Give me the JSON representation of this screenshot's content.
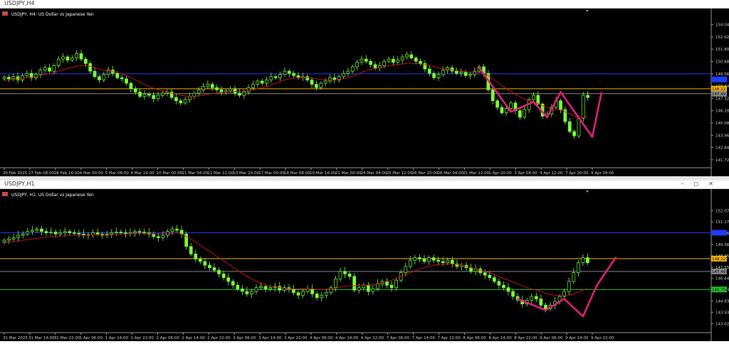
{
  "windows": [
    {
      "title": "USDJPY,H4",
      "header": "USDJPY, H4:  US Dollar vs Japanese Yen",
      "chart_data": {
        "type": "candlestick",
        "symbol": "USDJPY",
        "timeframe": "H4",
        "description": "US Dollar vs Japanese Yen",
        "ylim": [
          141.0,
          154.6
        ],
        "y_ticks": [
          "154.04",
          "152.92",
          "151.80",
          "150.68",
          "149.56",
          "148.44",
          "147.32",
          "146.20",
          "145.08",
          "143.96",
          "142.84",
          "141.72"
        ],
        "x_labels": [
          "26 Feb 2025",
          "27 Feb 08:00",
          "28 Feb 16:00",
          "4 Mar 00:00",
          "5 Mar 08:00",
          "6 Mar 16:00",
          "10 Mar 00:00",
          "11 Mar 04:00",
          "12 Mar 12:00",
          "13 Mar 20:00",
          "17 Mar 00:00",
          "18 Mar 08:00",
          "19 Mar 16:00",
          "21 Mar 00:00",
          "24 Mar 04:00",
          "25 Mar 12:00",
          "26 Mar 20:00",
          "28 Mar 04:00",
          "31 Mar 12:00",
          "1 Apr 20:00",
          "3 Apr 04:00",
          "4 Apr 12:00",
          "7 Apr 20:00",
          "9 Apr 04:00"
        ],
        "closes": [
          149.25,
          149.1,
          149.3,
          149.0,
          149.4,
          149.6,
          149.2,
          149.5,
          149.9,
          150.1,
          149.8,
          150.3,
          150.9,
          151.1,
          150.8,
          151.0,
          151.4,
          150.9,
          150.5,
          149.8,
          149.3,
          149.0,
          149.5,
          149.9,
          149.6,
          149.2,
          149.1,
          148.7,
          148.2,
          147.9,
          147.5,
          147.7,
          147.6,
          147.3,
          147.6,
          147.8,
          147.9,
          147.4,
          147.1,
          146.9,
          147.2,
          147.5,
          147.8,
          148.1,
          148.4,
          148.6,
          148.3,
          148.1,
          147.9,
          148.0,
          148.2,
          147.8,
          147.6,
          147.9,
          148.3,
          148.6,
          148.9,
          148.7,
          149.0,
          149.3,
          149.2,
          149.5,
          149.8,
          149.6,
          149.4,
          149.2,
          149.3,
          149.0,
          148.6,
          148.3,
          148.7,
          148.9,
          149.2,
          149.0,
          149.3,
          149.6,
          149.8,
          150.2,
          150.6,
          150.9,
          150.7,
          150.4,
          150.1,
          150.3,
          150.7,
          150.9,
          150.6,
          150.8,
          151.1,
          151.3,
          151.0,
          150.7,
          150.5,
          150.0,
          149.6,
          149.2,
          149.5,
          149.9,
          150.1,
          149.8,
          149.6,
          149.7,
          149.4,
          149.5,
          149.8,
          150.2,
          149.6,
          148.1,
          147.1,
          146.5,
          146.0,
          146.4,
          146.9,
          146.2,
          145.6,
          146.3,
          147.2,
          147.6,
          146.8,
          145.7,
          145.9,
          146.5,
          147.1,
          146.3,
          145.2,
          144.3,
          143.9,
          145.5,
          147.6,
          147.4
        ],
        "ma": [
          149.0,
          149.0,
          149.05,
          149.1,
          149.15,
          149.2,
          149.25,
          149.3,
          149.4,
          149.5,
          149.55,
          149.65,
          149.8,
          149.95,
          150.05,
          150.15,
          150.25,
          150.3,
          150.3,
          150.25,
          150.15,
          150.0,
          149.9,
          149.8,
          149.75,
          149.65,
          149.55,
          149.4,
          149.2,
          149.0,
          148.8,
          148.6,
          148.4,
          148.25,
          148.1,
          148.0,
          147.9,
          147.8,
          147.7,
          147.6,
          147.55,
          147.5,
          147.5,
          147.55,
          147.6,
          147.7,
          147.75,
          147.8,
          147.85,
          147.9,
          147.95,
          147.95,
          147.95,
          147.95,
          148.0,
          148.1,
          148.2,
          148.3,
          148.4,
          148.55,
          148.7,
          148.85,
          149.0,
          149.1,
          149.15,
          149.2,
          149.2,
          149.2,
          149.15,
          149.1,
          149.05,
          149.0,
          149.0,
          149.0,
          149.05,
          149.1,
          149.2,
          149.35,
          149.5,
          149.7,
          149.85,
          149.95,
          150.05,
          150.1,
          150.2,
          150.3,
          150.35,
          150.4,
          150.45,
          150.5,
          150.5,
          150.5,
          150.45,
          150.4,
          150.3,
          150.2,
          150.1,
          150.0,
          149.95,
          149.9,
          149.85,
          149.8,
          149.75,
          149.7,
          149.7,
          149.7,
          149.6,
          149.4,
          149.1,
          148.8,
          148.5,
          148.2,
          147.95,
          147.7,
          147.45,
          147.25,
          147.1,
          147.0,
          146.85,
          146.65,
          146.5,
          146.4,
          146.35,
          146.25,
          146.1,
          145.9,
          145.7,
          145.6,
          145.6,
          145.7
        ],
        "levels": [
          {
            "value": 149.56,
            "color": "#1e3cff"
          },
          {
            "value": 148.2,
            "color": "#f7b500"
          },
          {
            "value": 147.75,
            "color": "#8a8a8a"
          }
        ],
        "price_labels": [
          {
            "value": 149.05,
            "text": "",
            "color": "#1e3cff"
          },
          {
            "value": 148.2,
            "text": "148.22",
            "color": "#f7b500"
          },
          {
            "value": 147.75,
            "text": "147.49",
            "color": "#8a8a8a"
          }
        ],
        "pattern_points": [
          [
            105,
            150.1
          ],
          [
            112,
            146.1
          ],
          [
            117,
            147.0
          ],
          [
            120,
            145.6
          ],
          [
            123,
            147.9
          ],
          [
            130,
            143.8
          ],
          [
            132,
            147.8
          ]
        ],
        "pattern_color": "#e0207a",
        "candle_color": "#7cff3a",
        "ma_color": "#d01414",
        "grid": false
      }
    },
    {
      "title": "USDJPY,H1",
      "header": "USDJPY, H1:  US Dollar vs Japanese Yen",
      "chart_data": {
        "type": "candlestick",
        "symbol": "USDJPY",
        "timeframe": "H1",
        "description": "US Dollar vs Japanese Yen",
        "ylim": [
          142.3,
          153.0
        ],
        "y_ticks": [
          "152.075",
          "151.170",
          "150.265",
          "149.360",
          "148.455",
          "147.550",
          "146.645",
          "145.740",
          "144.835",
          "143.930",
          "143.025"
        ],
        "x_labels": [
          "31 Mar 2025",
          "31 Mar 14:00",
          "31 Mar 22:00",
          "1 Apr 06:00",
          "1 Apr 14:00",
          "1 Apr 22:00",
          "2 Apr 06:00",
          "2 Apr 14:00",
          "2 Apr 22:00",
          "3 Apr 06:00",
          "3 Apr 14:00",
          "3 Apr 22:00",
          "4 Apr 06:00",
          "4 Apr 14:00",
          "4 Apr 22:00",
          "7 Apr 06:00",
          "7 Apr 14:00",
          "7 Apr 22:00",
          "8 Apr 06:00",
          "8 Apr 14:00",
          "8 Apr 22:00",
          "9 Apr 06:00",
          "9 Apr 14:00",
          "9 Apr 22:00"
        ],
        "closes": [
          149.7,
          149.8,
          149.9,
          150.1,
          150.2,
          150.4,
          150.5,
          150.6,
          150.4,
          150.3,
          150.35,
          150.2,
          150.3,
          150.4,
          150.3,
          150.25,
          150.2,
          150.1,
          150.15,
          150.3,
          150.2,
          150.1,
          150.2,
          150.3,
          150.35,
          150.3,
          150.2,
          150.3,
          150.4,
          150.35,
          150.3,
          150.2,
          150.0,
          149.9,
          150.1,
          150.4,
          150.6,
          150.5,
          150.2,
          149.2,
          148.6,
          148.2,
          148.0,
          147.7,
          147.5,
          147.3,
          147.0,
          146.7,
          146.4,
          146.1,
          145.8,
          145.6,
          145.4,
          145.6,
          145.9,
          146.0,
          145.8,
          145.9,
          146.0,
          145.7,
          145.9,
          145.8,
          145.5,
          145.3,
          145.6,
          145.8,
          145.4,
          145.1,
          145.3,
          145.5,
          145.9,
          146.6,
          147.2,
          147.0,
          146.8,
          145.7,
          145.9,
          146.1,
          145.6,
          145.8,
          146.2,
          146.4,
          146.1,
          145.9,
          146.5,
          147.1,
          147.6,
          148.1,
          148.3,
          148.2,
          148.0,
          148.3,
          148.1,
          148.0,
          147.9,
          148.1,
          147.8,
          147.6,
          147.7,
          147.5,
          147.2,
          147.4,
          147.1,
          146.9,
          146.7,
          146.4,
          146.1,
          145.9,
          145.6,
          145.2,
          144.9,
          144.6,
          144.9,
          145.2,
          145.0,
          144.5,
          144.2,
          144.5,
          144.8,
          145.2,
          145.6,
          146.4,
          147.1,
          147.9,
          148.3,
          147.9
        ],
        "ma": [
          149.5,
          149.55,
          149.6,
          149.65,
          149.7,
          149.75,
          149.8,
          149.85,
          149.9,
          149.95,
          150.0,
          150.0,
          150.05,
          150.05,
          150.1,
          150.1,
          150.1,
          150.1,
          150.1,
          150.15,
          150.15,
          150.15,
          150.15,
          150.15,
          150.2,
          150.2,
          150.2,
          150.2,
          150.25,
          150.25,
          150.25,
          150.25,
          150.2,
          150.2,
          150.2,
          150.25,
          150.25,
          150.3,
          150.2,
          150.0,
          149.8,
          149.55,
          149.3,
          149.05,
          148.8,
          148.55,
          148.3,
          148.05,
          147.8,
          147.55,
          147.3,
          147.05,
          146.8,
          146.6,
          146.4,
          146.25,
          146.1,
          146.0,
          145.95,
          145.9,
          145.85,
          145.8,
          145.8,
          145.8,
          145.8,
          145.8,
          145.8,
          145.75,
          145.75,
          145.75,
          145.8,
          145.85,
          145.95,
          146.0,
          146.05,
          146.05,
          146.1,
          146.1,
          146.1,
          146.15,
          146.2,
          146.3,
          146.4,
          146.5,
          146.65,
          146.8,
          146.95,
          147.1,
          147.25,
          147.4,
          147.5,
          147.6,
          147.7,
          147.75,
          147.8,
          147.8,
          147.8,
          147.75,
          147.7,
          147.6,
          147.5,
          147.4,
          147.3,
          147.2,
          147.1,
          146.95,
          146.8,
          146.65,
          146.5,
          146.35,
          146.2,
          146.05,
          145.9,
          145.8,
          145.7,
          145.6,
          145.45,
          145.35,
          145.3,
          145.25,
          145.25,
          145.3,
          145.4,
          145.55,
          145.7,
          145.85
        ],
        "levels": [
          {
            "value": 150.3,
            "color": "#1e3cff"
          },
          {
            "value": 148.227,
            "color": "#f7b500"
          },
          {
            "value": 147.2,
            "color": "#8a8a8a"
          },
          {
            "value": 145.754,
            "color": "#23c423"
          }
        ],
        "price_labels": [
          {
            "value": 150.3,
            "text": "",
            "color": "#1e3cff"
          },
          {
            "value": 148.227,
            "text": "148.227",
            "color": "#f7b500"
          },
          {
            "value": 147.2,
            "text": "147.493",
            "color": "#8a8a8a"
          },
          {
            "value": 145.754,
            "text": "145.754",
            "color": "#23c423"
          }
        ],
        "pattern_points": [
          [
            110,
            145.0
          ],
          [
            116,
            144.1
          ],
          [
            120,
            145.0
          ],
          [
            124,
            143.6
          ],
          [
            127,
            146.1
          ],
          [
            131,
            148.3
          ]
        ],
        "pattern_color": "#e0207a",
        "candle_color": "#7cff3a",
        "ma_color": "#d01414",
        "grid": false
      }
    }
  ]
}
